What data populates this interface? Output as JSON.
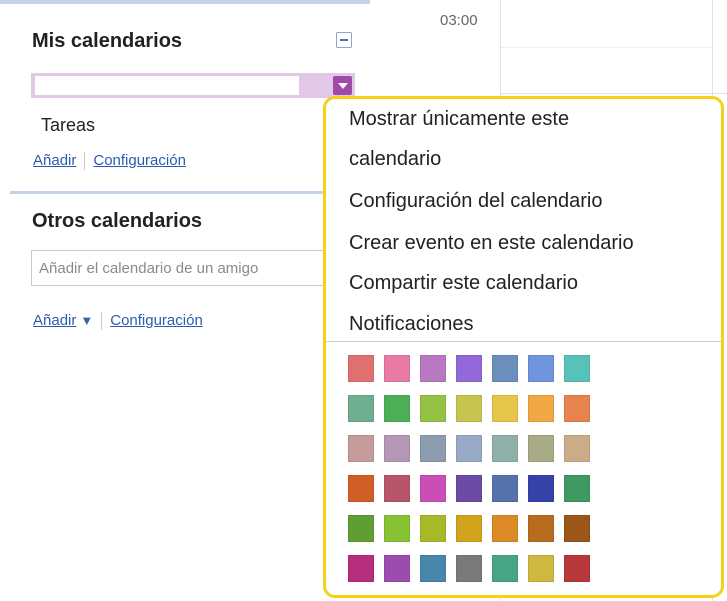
{
  "sidebar": {
    "my_calendars": {
      "title": "Mis calendarios",
      "calendar_name": "",
      "tasks_label": "Tareas",
      "add_link": "Añadir",
      "settings_link": "Configuración"
    },
    "other_calendars": {
      "title": "Otros calendarios",
      "friend_placeholder": "Añadir el calendario de un amigo",
      "add_link": "Añadir",
      "add_dropdown_symbol": "▼",
      "settings_link": "Configuración"
    }
  },
  "grid": {
    "time_label": "03:00"
  },
  "menu": {
    "items": [
      {
        "label_line1": "Mostrar únicamente este",
        "label_line2": "calendario"
      },
      {
        "label": "Configuración del calendario"
      },
      {
        "label": "Crear evento en este calendario"
      },
      {
        "label": "Compartir este calendario"
      },
      {
        "label": "Notificaciones"
      }
    ],
    "highlight_color": "#f5d11a",
    "palette": [
      [
        "#e06f6f",
        "#e87aa5",
        "#b879c2",
        "#9368db",
        "#6a8fbf",
        "#6e95de",
        "#58c2b8"
      ],
      [
        "#6fae8e",
        "#4caf58",
        "#95c244",
        "#c4c44f",
        "#e5c54a",
        "#f0a744",
        "#e8834e"
      ],
      [
        "#c49a9a",
        "#b497b4",
        "#8d9cae",
        "#98a9c8",
        "#8fb0aa",
        "#a8ab86",
        "#ccab88"
      ],
      [
        "#cf5f26",
        "#b9556a",
        "#c94fb7",
        "#6b4ba5",
        "#5572aa",
        "#3742a8",
        "#3e9a62"
      ],
      [
        "#5f9e33",
        "#87c232",
        "#a9b829",
        "#d1a41b",
        "#db8a26",
        "#b86d1e",
        "#9b5618"
      ],
      [
        "#b62f7d",
        "#9c4caf",
        "#4a86ab",
        "#7a7a7a",
        "#47a486",
        "#d0b73f",
        "#b7373a"
      ]
    ]
  }
}
